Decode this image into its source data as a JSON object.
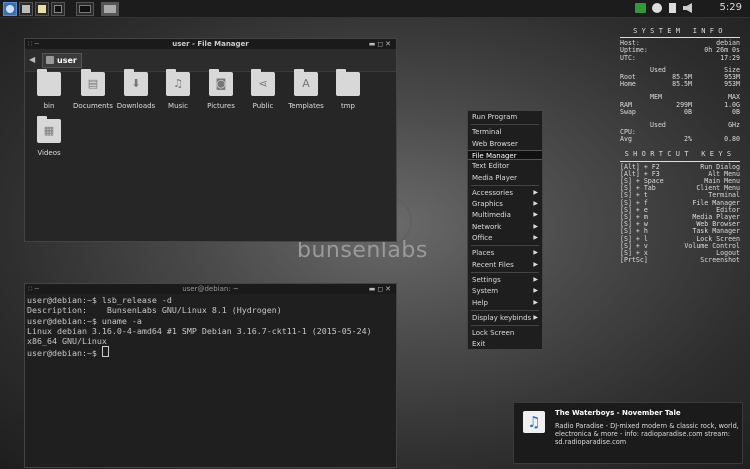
{
  "panel": {
    "clock": "5:29",
    "launchers": [
      "menu-icon",
      "file-manager-icon",
      "text-editor-icon",
      "terminal-icon"
    ],
    "tasks": [
      "terminal-task-icon",
      "file-manager-task-icon"
    ],
    "tray": [
      "battery-icon",
      "network-icon",
      "clipboard-icon",
      "volume-icon"
    ]
  },
  "wallpaper": {
    "brand": "bunsenlabs"
  },
  "file_manager": {
    "title": "user - File Manager",
    "breadcrumb": "user",
    "items": [
      {
        "label": "bin",
        "icon": "folder-icon",
        "symbol": ""
      },
      {
        "label": "Documents",
        "icon": "documents-folder-icon",
        "symbol": "▤"
      },
      {
        "label": "Downloads",
        "icon": "downloads-folder-icon",
        "symbol": "⬇"
      },
      {
        "label": "Music",
        "icon": "music-folder-icon",
        "symbol": "♫"
      },
      {
        "label": "Pictures",
        "icon": "pictures-folder-icon",
        "symbol": "◙"
      },
      {
        "label": "Public",
        "icon": "public-folder-icon",
        "symbol": "⋖"
      },
      {
        "label": "Templates",
        "icon": "templates-folder-icon",
        "symbol": "A"
      },
      {
        "label": "tmp",
        "icon": "folder-icon",
        "symbol": ""
      },
      {
        "label": "Videos",
        "icon": "videos-folder-icon",
        "symbol": "▦"
      }
    ]
  },
  "terminal": {
    "title": "user@debian: ~",
    "lines": [
      "user@debian:~$ lsb_release -d",
      "Description:    BunsenLabs GNU/Linux 8.1 (Hydrogen)",
      "user@debian:~$ uname -a",
      "Linux debian 3.16.0-4-amd64 #1 SMP Debian 3.16.7-ckt11-1 (2015-05-24)",
      "x86_64 GNU/Linux",
      "user@debian:~$ "
    ]
  },
  "menu": {
    "items": [
      {
        "label": "Run Program",
        "submenu": false
      },
      {
        "label": "Terminal",
        "submenu": false
      },
      {
        "label": "Web Browser",
        "submenu": false
      },
      {
        "label": "File Manager",
        "submenu": false,
        "selected": true
      },
      {
        "label": "Text Editor",
        "submenu": false
      },
      {
        "label": "Media Player",
        "submenu": false
      },
      {
        "label": "Accessories",
        "submenu": true
      },
      {
        "label": "Graphics",
        "submenu": true
      },
      {
        "label": "Multimedia",
        "submenu": true
      },
      {
        "label": "Network",
        "submenu": true
      },
      {
        "label": "Office",
        "submenu": true
      },
      {
        "label": "Places",
        "submenu": true
      },
      {
        "label": "Recent Files",
        "submenu": true
      },
      {
        "label": "Settings",
        "submenu": true
      },
      {
        "label": "System",
        "submenu": true
      },
      {
        "label": "Help",
        "submenu": true
      },
      {
        "label": "Display keybinds",
        "submenu": true
      },
      {
        "label": "Lock Screen",
        "submenu": false
      },
      {
        "label": "Exit",
        "submenu": false
      }
    ]
  },
  "conky": {
    "system_header": "SYSTEM INFO",
    "host_label": "Host:",
    "host": "debian",
    "uptime_label": "Uptime:",
    "uptime": "0h 26m 0s",
    "utc_label": "UTC:",
    "utc": "17:29",
    "disk_used_header": "Used",
    "disk_size_header": "Size",
    "disk": [
      {
        "name": "Root",
        "used": "85.5M",
        "size": "953M"
      },
      {
        "name": "Home",
        "used": "85.5M",
        "size": "953M"
      }
    ],
    "mem_mem_header": "MEM",
    "mem_max_header": "MAX",
    "mem": [
      {
        "name": "RAM",
        "mem": "299M",
        "max": "1.0G"
      },
      {
        "name": "Swap",
        "mem": "0B",
        "max": "0B"
      }
    ],
    "cpu_used_header": "Used",
    "cpu_ghz_header": "GHz",
    "cpu": [
      {
        "name": "CPU:",
        "used": "",
        "ghz": ""
      },
      {
        "name": "Avg",
        "used": "2%",
        "ghz": "0.80"
      }
    ],
    "shortcut_header": "SHORTCUT KEYS",
    "shortcuts": [
      {
        "key": "[Alt] + F2",
        "action": "Run Dialog"
      },
      {
        "key": "[Alt] + F3",
        "action": "Alt Menu"
      },
      {
        "key": "[S] + Space",
        "action": "Main Menu"
      },
      {
        "key": "[S] + Tab",
        "action": "Client Menu"
      },
      {
        "key": "[S] + t",
        "action": "Terminal"
      },
      {
        "key": "[S] + f",
        "action": "File Manager"
      },
      {
        "key": "[S] + e",
        "action": "Editor"
      },
      {
        "key": "[S] + m",
        "action": "Media Player"
      },
      {
        "key": "[S] + w",
        "action": "Web Browser"
      },
      {
        "key": "[S] + h",
        "action": "Task Manager"
      },
      {
        "key": "[S] + l",
        "action": "Lock Screen"
      },
      {
        "key": "[S] + v",
        "action": "Volume Control"
      },
      {
        "key": "[S] + x",
        "action": "Logout"
      },
      {
        "key": "[PrtSc]",
        "action": "Screenshot"
      }
    ]
  },
  "notification": {
    "title": "The Waterboys - November Tale",
    "body": "Radio Paradise - DJ-mixed modern & classic rock, world, electronica & more - info: radioparadise.com stream: sd.radioparadise.com",
    "icon": "music-note-icon"
  }
}
